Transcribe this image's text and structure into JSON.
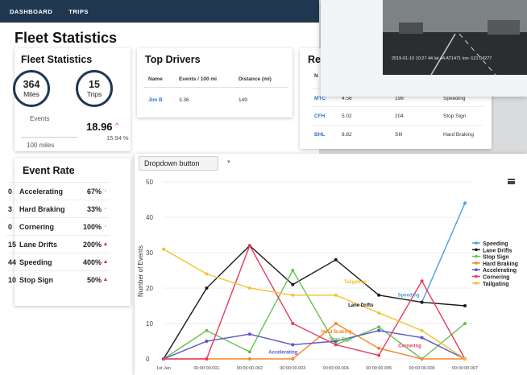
{
  "nav": {
    "dashboard": "DASHBOARD",
    "trips": "TRIPS"
  },
  "page": {
    "title": "Fleet Statistics"
  },
  "stats": {
    "title": "Fleet Statistics",
    "miles_value": "364",
    "miles_unit": "Miles",
    "trips_value": "15",
    "trips_unit": "Trips",
    "events_label": "Events",
    "events_value": "18.96",
    "events_pct": "15.94 %",
    "miles_label": "100 miles"
  },
  "drivers": {
    "title": "Top Drivers",
    "headers": [
      "Name",
      "Events / 100 mi",
      "Distance (mi)"
    ],
    "rows": [
      {
        "name": "Jim B",
        "events": "3.36",
        "distance": "149"
      }
    ]
  },
  "recent": {
    "title": "Re",
    "header_n": "N",
    "rows": [
      {
        "id": "MTC",
        "v1": "4.56",
        "v2": "198",
        "type": "Speeding"
      },
      {
        "id": "CFH",
        "v1": "5.02",
        "v2": "204",
        "type": "Stop Sign"
      },
      {
        "id": "BHL",
        "v1": "8.82",
        "v2": "SIll",
        "type": "Hard Braking"
      }
    ]
  },
  "video": {
    "timestamp": "2019-01-10 10:27 44 lat 44 AT1471 lon:-121.04277"
  },
  "event_rate": {
    "title": "Event Rate",
    "rows": [
      {
        "count": "0",
        "label": "Accelerating",
        "pct": "67%",
        "trend": "down"
      },
      {
        "count": "3",
        "label": "Hard Braking",
        "pct": "33%",
        "trend": "down"
      },
      {
        "count": "0",
        "label": "Cornering",
        "pct": "100%",
        "trend": "down"
      },
      {
        "count": "15",
        "label": "Lane Drifts",
        "pct": "200%",
        "trend": "up"
      },
      {
        "count": "44",
        "label": "Speeding",
        "pct": "400%",
        "trend": "up"
      },
      {
        "count": "10",
        "label": "Stop Sign",
        "pct": "50%",
        "trend": "up"
      }
    ]
  },
  "chart_toolbar": {
    "dropdown_label": "Dropdown button"
  },
  "colors": {
    "nav_bg": "#20384f",
    "up": "#e0313c",
    "down": "#59b84f",
    "link": "#2f74c9"
  },
  "chart_data": {
    "type": "line",
    "ylabel": "Number of Events",
    "ylim": [
      0,
      50
    ],
    "yticks": [
      0,
      10,
      20,
      30,
      40,
      50
    ],
    "categories": [
      "1st Jan",
      "00:00:00.001",
      "00:00:00.002",
      "00:00:00.003",
      "00:00:00.004",
      "00:00:00.005",
      "00:00:00.006",
      "00:00:00.007"
    ],
    "series": [
      {
        "name": "Speeding",
        "color": "#4a9fe0",
        "values": [
          null,
          null,
          null,
          null,
          null,
          null,
          16,
          44
        ],
        "label": "Speeding"
      },
      {
        "name": "Lane Drifts",
        "color": "#1a1a1a",
        "values": [
          0,
          20,
          32,
          21,
          28,
          18,
          16,
          15
        ],
        "label": "Lane Drifts"
      },
      {
        "name": "Stop Sign",
        "color": "#66c24e",
        "values": [
          0,
          8,
          2,
          25,
          4,
          9,
          0,
          10
        ],
        "label": "Stop Sign"
      },
      {
        "name": "Hard Braking",
        "color": "#f08a2a",
        "values": [
          0,
          0,
          0,
          0,
          10,
          3,
          0,
          0
        ],
        "label": "Hard Braking"
      },
      {
        "name": "Accelerating",
        "color": "#5a54c8",
        "values": [
          0,
          5,
          7,
          4,
          5,
          8,
          6,
          0
        ],
        "label": "Accelerating"
      },
      {
        "name": "Cornering",
        "color": "#e63b5e",
        "values": [
          0,
          0,
          32,
          10,
          4,
          1,
          22,
          0
        ],
        "label": "Cornering"
      },
      {
        "name": "Tailgating",
        "color": "#f2c330",
        "values": [
          31,
          24,
          20,
          18,
          18,
          13,
          8,
          0
        ],
        "label": "Tailgating"
      }
    ],
    "legend_position": "right",
    "grid": true
  }
}
